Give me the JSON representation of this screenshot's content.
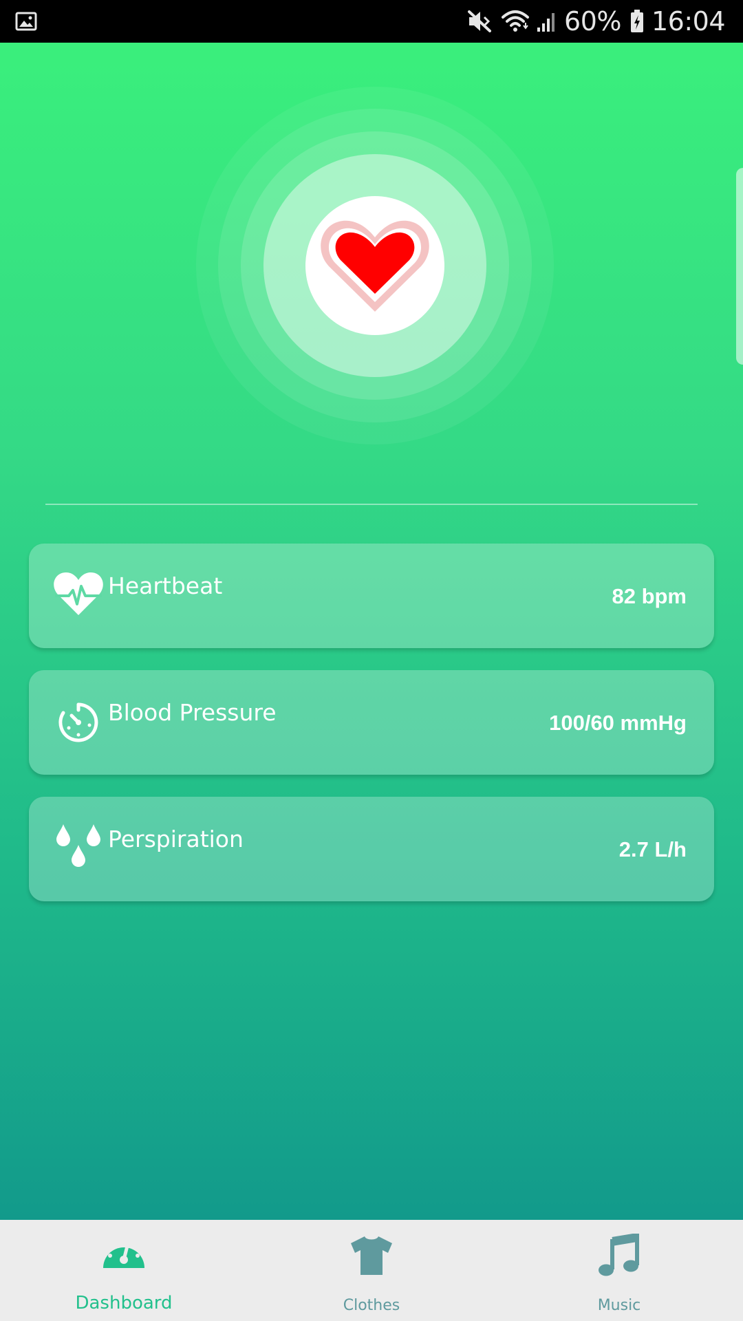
{
  "status_bar": {
    "battery_percent": "60%",
    "time": "16:04",
    "icons": [
      "gallery-icon",
      "mute-icon",
      "wifi-icon",
      "signal-icon",
      "battery-charging-icon"
    ]
  },
  "hero": {
    "icon": "heart-icon",
    "heart_color": "#ff0000",
    "heart_outline_color": "#f4c3c3"
  },
  "metrics": [
    {
      "label": "Heartbeat",
      "value": "82 bpm",
      "icon": "heartbeat-icon"
    },
    {
      "label": "Blood Pressure",
      "value": "100/60 mmHg",
      "icon": "gauge-timer-icon"
    },
    {
      "label": "Perspiration",
      "value": "2.7 L/h",
      "icon": "water-drops-icon"
    }
  ],
  "bottom_nav": {
    "items": [
      {
        "label": "Dashboard",
        "icon": "speedometer-icon",
        "active": true
      },
      {
        "label": "Clothes",
        "icon": "tshirt-icon",
        "active": false
      },
      {
        "label": "Music",
        "icon": "music-note-icon",
        "active": false
      }
    ]
  },
  "colors": {
    "gradient_top": "#3aef7c",
    "gradient_bottom": "#129a8b",
    "nav_active": "#22c08c",
    "nav_inactive": "#5f9a9e",
    "nav_background": "#ececec"
  }
}
